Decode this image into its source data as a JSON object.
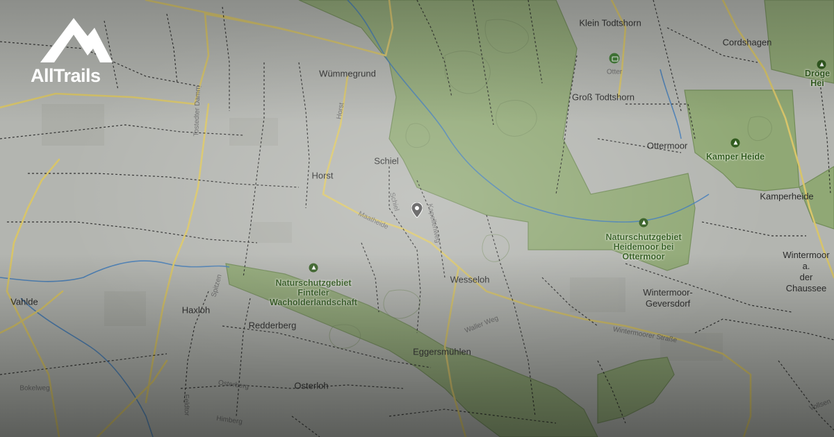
{
  "brand": {
    "name": "AllTrails",
    "logo_icon": "mountain-logo-icon"
  },
  "map": {
    "places": [
      {
        "id": "klein-todtshorn",
        "text": "Klein Todtshorn"
      },
      {
        "id": "cordshagen",
        "text": "Cordshagen"
      },
      {
        "id": "wuemmegrund",
        "text": "Wümmegrund"
      },
      {
        "id": "otter",
        "text": "Otter"
      },
      {
        "id": "gross-todtshorn",
        "text": "Groß Todtshorn"
      },
      {
        "id": "ottermoor",
        "text": "Ottermoor"
      },
      {
        "id": "schiel",
        "text": "Schiel"
      },
      {
        "id": "horst",
        "text": "Horst"
      },
      {
        "id": "kamperheide",
        "text": "Kamperheide"
      },
      {
        "id": "wesseloh",
        "text": "Wesseloh"
      },
      {
        "id": "wintermoor-chaussee",
        "text": "Wintermoor a.\nder Chaussee"
      },
      {
        "id": "vahlde",
        "text": "Vahlde"
      },
      {
        "id": "haxloh",
        "text": "Haxloh"
      },
      {
        "id": "redderberg",
        "text": "Redderberg"
      },
      {
        "id": "wintermoor-geversdorf",
        "text": "Wintermoor-\nGeversdorf"
      },
      {
        "id": "eggersmuehlen",
        "text": "Eggersmühlen"
      },
      {
        "id": "osterloh",
        "text": "Osterloh"
      }
    ],
    "roads": [
      {
        "id": "tostedter-damm",
        "text": "Tostedter Damm"
      },
      {
        "id": "horst-road",
        "text": "Horst"
      },
      {
        "id": "maatheide",
        "text": "Maatheide"
      },
      {
        "id": "schiel-road",
        "text": "Schiel"
      },
      {
        "id": "kapellenweg",
        "text": "Kapellenweg"
      },
      {
        "id": "spitzen",
        "text": "Spitzen"
      },
      {
        "id": "waller-weg",
        "text": "Waller Weg"
      },
      {
        "id": "wintermoorer-strasse",
        "text": "Wintermoorer Straße"
      },
      {
        "id": "bokelweg",
        "text": "Bokelweg"
      },
      {
        "id": "osterberg",
        "text": "Osterberg"
      },
      {
        "id": "himberg",
        "text": "Himberg"
      },
      {
        "id": "feldtor",
        "text": "Feldtor"
      },
      {
        "id": "vollsen",
        "text": "Vollsen"
      }
    ],
    "parks": [
      {
        "id": "droge-heide",
        "text": "Dröge Hei"
      },
      {
        "id": "kamper-heide",
        "text": "Kamper Heide"
      },
      {
        "id": "heidemoor",
        "text": "Naturschutzgebiet\nHeidemoor bei\nOttermoor"
      },
      {
        "id": "finteler",
        "text": "Naturschutzgebiet\nFinteler\nWacholderlandschaft"
      }
    ]
  },
  "colors": {
    "land": "#b3b5b0",
    "park": "#8fa872",
    "park_edge": "#6f8a55",
    "major_road": "#d8c56a",
    "trail": "#1b1b1b",
    "water": "#3d79b8",
    "pin": "#4a4a4a"
  }
}
